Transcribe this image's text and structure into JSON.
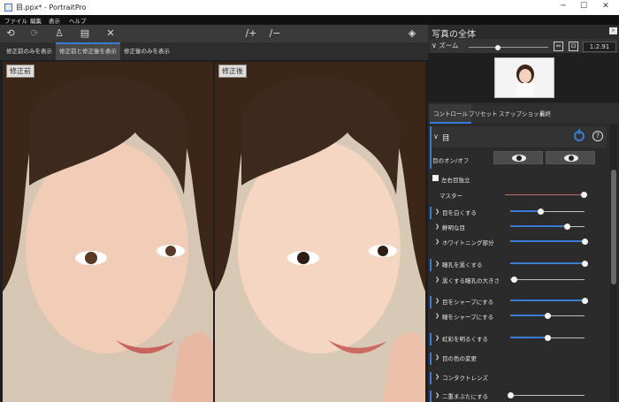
{
  "window": {
    "title": "目.ppx* - PortraitPro",
    "min": "─",
    "max": "☐",
    "close": "✕"
  },
  "menu": {
    "file": "ファイル",
    "edit": "編集",
    "view": "表示",
    "help": "ヘルプ"
  },
  "toolbar": {
    "undo": "⟲",
    "redo": "⟳",
    "person": "♙",
    "doc": "▤",
    "close": "✕",
    "brush_plus": "∕+",
    "brush_minus": "∕−",
    "layers": "◈"
  },
  "view_tabs": {
    "before_only": "修正前のみを表示",
    "before_after": "修正前と修正後を表示",
    "after_only": "修正後のみを表示"
  },
  "labels": {
    "before": "修正前",
    "after": "修正後"
  },
  "panel": {
    "title": "写真の全体",
    "zoom_label": "ズーム",
    "zoom_value": "1:2.91",
    "zoom_level": 0.37
  },
  "control_tabs": {
    "controls": "コントロール",
    "presets": "プリセット",
    "snapshot": "スナップショット",
    "final": "最終"
  },
  "section": {
    "title": "目",
    "eye_toggle_label": "目のオン/オフ",
    "separate_label": "左右目独立",
    "mask_label": "マスター",
    "mask_level": 1.0
  },
  "sliders": [
    {
      "label": "目を白くする",
      "value": 0.4
    },
    {
      "label": "鮮明な目",
      "value": 0.76
    },
    {
      "label": "ホワイトニング部分",
      "value": 1.0
    },
    {
      "label": "瞳孔を黒くする",
      "value": 1.0
    },
    {
      "label": "黒くする瞳孔の大きさ",
      "value": 0.05
    },
    {
      "label": "目をシャープにする",
      "value": 1.0
    },
    {
      "label": "瞳をシャープにする",
      "value": 0.5
    },
    {
      "label": "虹彩を明るくする",
      "value": 0.5
    },
    {
      "label": "目の色の変更",
      "value": null
    },
    {
      "label": "コンタクトレンズ",
      "value": null
    },
    {
      "label": "二重まぶたにする",
      "value": 0.0
    }
  ],
  "colors": {
    "accent": "#3a7bd5",
    "mask": "#c46a6a",
    "panel_bg": "#2b2b2b"
  },
  "icons": {
    "power": "power-icon",
    "help": "?",
    "chev": "❯",
    "chev_down": "❯"
  }
}
